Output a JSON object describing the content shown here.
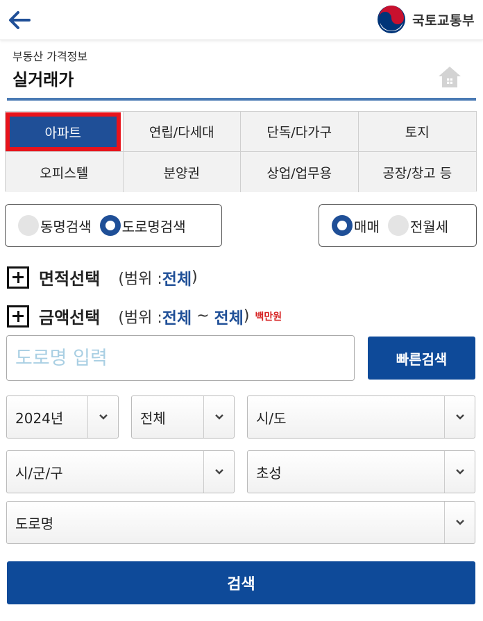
{
  "topbar": {
    "back_icon": "arrow-left-icon",
    "logo_text": "국토교통부",
    "colors": {
      "arrow": "#1f4f97",
      "logo_red": "#c8102e",
      "logo_blue": "#003478"
    }
  },
  "header": {
    "subtitle": "부동산 가격정보",
    "title": "실거래가",
    "home_icon": "home-icon"
  },
  "tabs": [
    {
      "label": "아파트",
      "active": true
    },
    {
      "label": "연립/다세대"
    },
    {
      "label": "단독/다가구"
    },
    {
      "label": "토지"
    },
    {
      "label": "오피스텔"
    },
    {
      "label": "분양권"
    },
    {
      "label": "상업/업무용"
    },
    {
      "label": "공장/창고 등"
    }
  ],
  "search_mode": {
    "options": [
      {
        "label": "동명검색",
        "selected": false
      },
      {
        "label": "도로명검색",
        "selected": true
      }
    ]
  },
  "trade_type": {
    "options": [
      {
        "label": "매매",
        "selected": true
      },
      {
        "label": "전월세",
        "selected": false
      }
    ]
  },
  "area_filter": {
    "label": "면적선택",
    "range_prefix": "(범위 : ",
    "value": "전체",
    "range_suffix": ")"
  },
  "price_filter": {
    "label": "금액선택",
    "range_prefix": "(범위 : ",
    "min": "전체",
    "separator": " ~ ",
    "max": "전체",
    "range_suffix": ")",
    "unit": "백만원"
  },
  "road_input": {
    "placeholder": "도로명 입력",
    "value": ""
  },
  "quick_search_label": "빠른검색",
  "selects": {
    "year": "2024년",
    "period": "전체",
    "sido": "시/도",
    "sigungu": "시/군/구",
    "initial": "초성",
    "road": "도로명"
  },
  "search_label": "검색",
  "colors": {
    "primary": "#0e4a99",
    "accent_red": "#e8131b",
    "range_blue": "#1f4f97",
    "unit_red": "#d62020"
  }
}
